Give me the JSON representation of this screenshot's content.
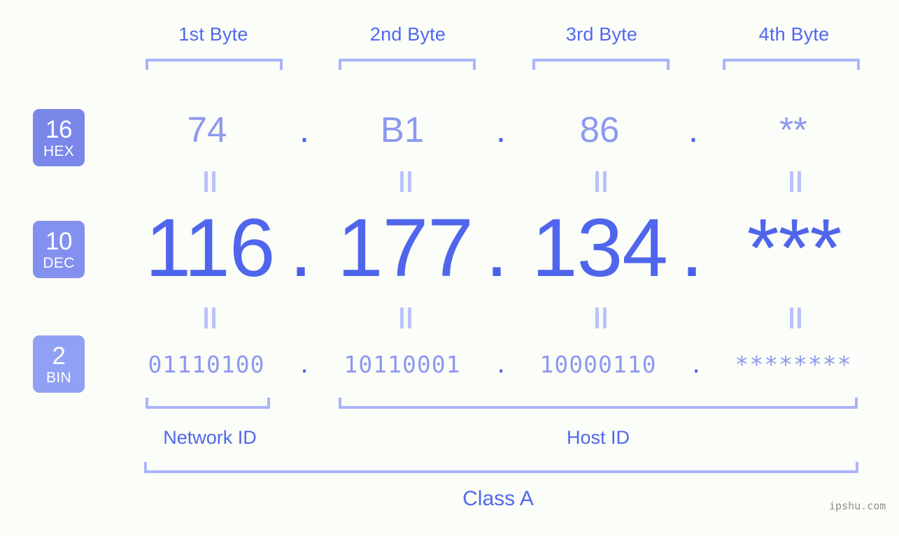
{
  "background_color": "#fbfdf8",
  "accent_colors": {
    "strong_blue": "#4f66ec",
    "mid_blue": "#5068ee",
    "light_blue": "#8d99ef",
    "bracket_blue": "#aab4fb",
    "badge_hex": "#7a87e9",
    "badge_dec": "#8490ef",
    "badge_bin": "#8fa0f5"
  },
  "byte_headers": [
    {
      "label": "1st Byte"
    },
    {
      "label": "2nd Byte"
    },
    {
      "label": "3rd Byte"
    },
    {
      "label": "4th Byte"
    }
  ],
  "rows": {
    "hex": {
      "badge_number": "16",
      "badge_name": "HEX",
      "values": [
        "74",
        "B1",
        "86",
        "**"
      ],
      "separator": "."
    },
    "dec": {
      "badge_number": "10",
      "badge_name": "DEC",
      "values": [
        "116",
        "177",
        "134",
        "***"
      ],
      "separator": "."
    },
    "bin": {
      "badge_number": "2",
      "badge_name": "BIN",
      "values": [
        "01110100",
        "10110001",
        "10000110",
        "********"
      ],
      "separator": "."
    }
  },
  "equals_marks": {
    "glyph": "=",
    "count_per_row": 4
  },
  "id_sections": [
    {
      "label": "Network ID"
    },
    {
      "label": "Host ID"
    }
  ],
  "class_label": "Class A",
  "watermark": "ipshu.com"
}
